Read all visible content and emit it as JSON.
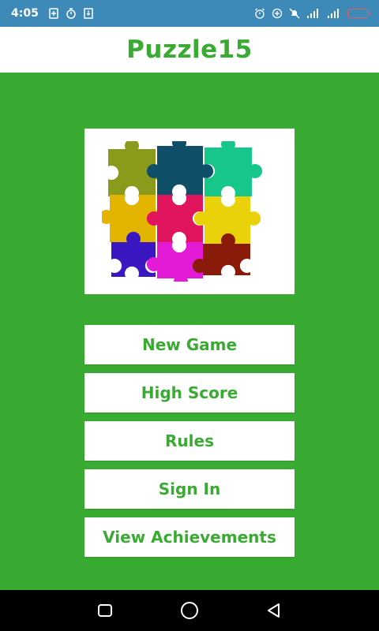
{
  "status_bar": {
    "time": "4:05"
  },
  "app_bar": {
    "title": "Puzzle15"
  },
  "menu": {
    "new_game": "New Game",
    "high_score": "High Score",
    "rules": "Rules",
    "sign_in": "Sign In",
    "view_achievements": "View Achievements"
  },
  "colors": {
    "accent": "#3aab32",
    "status_bar": "#3d8ab8",
    "puzzle_pieces": [
      "#8a9a1a",
      "#0f4f6a",
      "#17c78a",
      "#e3b400",
      "#e0155e",
      "#e9d20a",
      "#3a17c0",
      "#e31ad6",
      "#8a1a0a"
    ]
  },
  "icons": {
    "status_left": [
      "battery-saver-icon",
      "timer-icon",
      "download-icon"
    ],
    "status_right": [
      "alarm-icon",
      "data-saver-icon",
      "mute-icon",
      "signal-icon",
      "signal-icon",
      "battery-icon"
    ],
    "nav": [
      "recents-icon",
      "home-icon",
      "back-icon"
    ]
  }
}
